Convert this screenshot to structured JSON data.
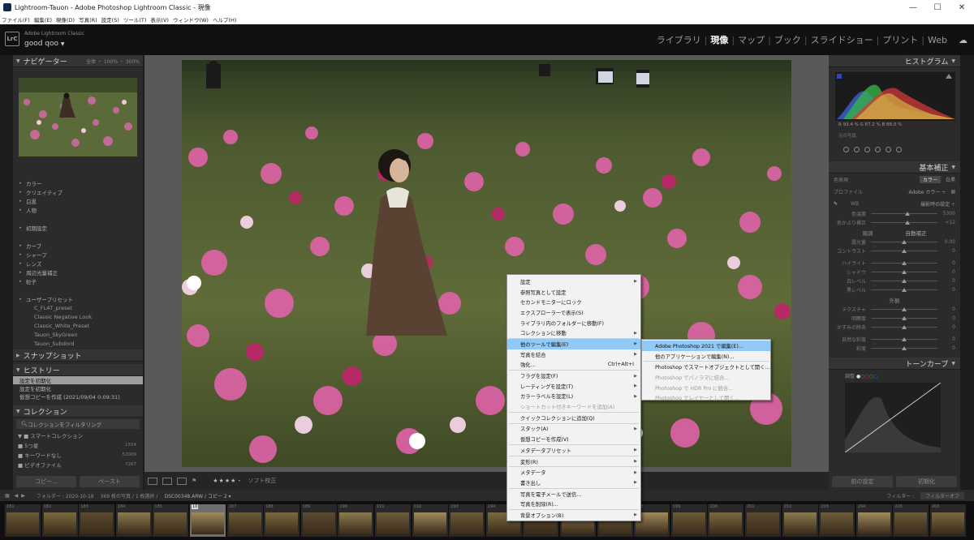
{
  "window": {
    "title": "Lightroom-Tauon - Adobe Photoshop Lightroom Classic - 現像",
    "minimize": "—",
    "maximize": "☐",
    "close": "✕"
  },
  "menubar": [
    "ファイル(F)",
    "編集(E)",
    "現像(D)",
    "写真(R)",
    "設定(S)",
    "ツール(T)",
    "表示(V)",
    "ウィンドウ(W)",
    "ヘルプ(H)"
  ],
  "identity": {
    "logo": "LrC",
    "brand": "Adobe Lightroom Classic",
    "user": "good qoo",
    "user_arrow": "▼"
  },
  "modules": {
    "items": [
      "ライブラリ",
      "現像",
      "マップ",
      "ブック",
      "スライドショー",
      "プリント",
      "Web"
    ],
    "active": "現像",
    "separator": "|"
  },
  "left": {
    "navigator": {
      "title": "ナビゲーター",
      "zoom": "全体 ・ 100% ・ 300%"
    },
    "presets": [
      {
        "label": "カラー",
        "sub": false
      },
      {
        "label": "クリエイティブ",
        "sub": false
      },
      {
        "label": "白黒",
        "sub": false
      },
      {
        "label": "人物",
        "sub": false
      },
      {
        "label": "",
        "sub": false
      },
      {
        "label": "初期設定",
        "sub": false
      },
      {
        "label": "",
        "sub": false
      },
      {
        "label": "カーブ",
        "sub": false
      },
      {
        "label": "シャープ",
        "sub": false
      },
      {
        "label": "レンズ",
        "sub": false
      },
      {
        "label": "周辺光量補正",
        "sub": false
      },
      {
        "label": "粒子",
        "sub": false
      },
      {
        "label": "",
        "sub": false
      },
      {
        "label": "ユーザープリセット",
        "sub": false
      },
      {
        "label": "C_FLAT_preset",
        "sub": true
      },
      {
        "label": "Classic Negative Look",
        "sub": true
      },
      {
        "label": "Classic_White_Preset",
        "sub": true
      },
      {
        "label": "Tauon_SkyGreen",
        "sub": true
      },
      {
        "label": "Tauon_Subdord",
        "sub": true
      }
    ],
    "snapshot_title": "スナップショット",
    "history_title": "ヒストリー",
    "history": [
      "設定を初期化",
      "設定を初期化",
      "仮想コピーを作成 (2021/09/04 0:09:31)"
    ],
    "collection_title": "コレクション",
    "collection_filter": "コレクションをフィルタリング",
    "collections": [
      {
        "label": "▼ ■ スマートコレクション",
        "count": ""
      },
      {
        "label": "    ■ 5つ星",
        "count": "1554"
      },
      {
        "label": "    ■ キーワードなし",
        "count": "52009"
      },
      {
        "label": "    ■ ビデオファイル",
        "count": "7267"
      }
    ],
    "copy_button": "コピー...",
    "paste_button": "ペースト"
  },
  "toolbar": {
    "stars": "★★★★・",
    "soft_proof": "ソフト校正"
  },
  "right": {
    "histogram_title": "ヒストグラム",
    "histo_readout": "R  93.4  %   G  87.2  %   B  88.0  %",
    "histo_sub": "元の写真",
    "basic_title": "基本補正",
    "treatment_label": "色表現",
    "treatment_color": "カラー",
    "treatment_bw": "白黒",
    "profile_label": "プロファイル",
    "profile_value": "Adobe カラー ÷",
    "wb_label": "WB",
    "wb_value": "撮影時の設定 ÷",
    "tone_group": "階調",
    "tone_auto": "自動補正",
    "presence_group": "外観",
    "sliders": [
      {
        "label": "色温度",
        "value": "5300",
        "pos": 0.55,
        "group": "wb"
      },
      {
        "label": "色かぶり補正",
        "value": "+12",
        "pos": 0.55,
        "group": "wb"
      },
      {
        "label": "露光量",
        "value": "0.00",
        "pos": 0.5,
        "group": "tone"
      },
      {
        "label": "コントラスト",
        "value": "0",
        "pos": 0.5,
        "group": "tone"
      },
      {
        "label": "ハイライト",
        "value": "0",
        "pos": 0.5,
        "group": "tone2"
      },
      {
        "label": "シャドウ",
        "value": "0",
        "pos": 0.5,
        "group": "tone2"
      },
      {
        "label": "白レベル",
        "value": "0",
        "pos": 0.5,
        "group": "tone2"
      },
      {
        "label": "黒レベル",
        "value": "0",
        "pos": 0.5,
        "group": "tone2"
      },
      {
        "label": "テクスチャ",
        "value": "0",
        "pos": 0.5,
        "group": "presence"
      },
      {
        "label": "明瞭度",
        "value": "0",
        "pos": 0.5,
        "group": "presence"
      },
      {
        "label": "かすみの除去",
        "value": "0",
        "pos": 0.5,
        "group": "presence"
      },
      {
        "label": "自然な彩度",
        "value": "0",
        "pos": 0.5,
        "group": "presence2"
      },
      {
        "label": "彩度",
        "value": "0",
        "pos": 0.5,
        "group": "presence2"
      }
    ],
    "tonecurve_title": "トーンカーブ",
    "tonecurve_adjust": "調整",
    "prev_button": "前の設定",
    "reset_button": "初期化"
  },
  "filmbar": {
    "source": "フォルダー : 2020-10-18",
    "count": "369 枚の写真 / 1 枚選択 /",
    "file": "DSC00348.ARW / コピー 2 ▾",
    "filter_label": "フィルター :",
    "filter_value": "フィルターオフ"
  },
  "filmstrip": {
    "numbers": [
      "181",
      "182",
      "183",
      "184",
      "185",
      "10",
      "187",
      "188",
      "189",
      "190",
      "191",
      "192",
      "193",
      "194",
      "195",
      "196",
      "197",
      "198",
      "199",
      "200",
      "201",
      "202",
      "203",
      "204",
      "205",
      "206"
    ],
    "selected_index": 5
  },
  "context_menu": {
    "items": [
      {
        "label": "設定",
        "arrow": true
      },
      {
        "label": "参照写真として設定"
      },
      {
        "label": "セカンドモニターにロック"
      },
      {
        "label": "エクスプローラーで表示(S)"
      },
      {
        "label": "ライブラリ内のフォルダーに移動(F)"
      },
      {
        "label": "コレクションに移動",
        "arrow": true
      },
      {
        "divider": true
      },
      {
        "label": "他のツールで編集(E)",
        "arrow": true,
        "highlight": true
      },
      {
        "label": "写真を結合",
        "arrow": true
      },
      {
        "label": "強化...",
        "acc": "Ctrl+Alt+I"
      },
      {
        "divider": true
      },
      {
        "label": "フラグを設定(F)",
        "arrow": true
      },
      {
        "label": "レーティングを設定(T)",
        "arrow": true
      },
      {
        "label": "カラーラベルを設定(L)",
        "arrow": true
      },
      {
        "label": "ショートカット付きキーワードを追加(A)",
        "disabled": true
      },
      {
        "divider": true
      },
      {
        "label": "クイックコレクションに追加(Q)"
      },
      {
        "divider": true
      },
      {
        "label": "スタック(A)",
        "arrow": true
      },
      {
        "label": "仮想コピーを作成(V)"
      },
      {
        "divider": true
      },
      {
        "label": "メタデータプリセット",
        "arrow": true
      },
      {
        "divider": true
      },
      {
        "label": "変形(R)",
        "arrow": true
      },
      {
        "divider": true
      },
      {
        "label": "メタデータ",
        "arrow": true
      },
      {
        "label": "書き出し",
        "arrow": true
      },
      {
        "divider": true
      },
      {
        "label": "写真を電子メールで送信..."
      },
      {
        "label": "写真を削除(R)..."
      },
      {
        "divider": true
      },
      {
        "label": "背景オプション(B)",
        "arrow": true
      }
    ]
  },
  "submenu": {
    "items": [
      {
        "label": "Adobe Photoshop 2021 で編集(E)...",
        "highlight": true
      },
      {
        "label": "他のアプリケーションで編集(N)..."
      },
      {
        "divider": true
      },
      {
        "label": "Photoshop でスマートオブジェクトとして開く..."
      },
      {
        "label": "Photoshop でパノラマに結合...",
        "disabled": true
      },
      {
        "label": "Photoshop で HDR Pro に統合...",
        "disabled": true
      },
      {
        "label": "Photoshop でレイヤーとして開く...",
        "disabled": true
      }
    ]
  },
  "colors": {
    "highlight": "#91c9f7",
    "panel": "#2b2b2b",
    "center": "#595959"
  }
}
